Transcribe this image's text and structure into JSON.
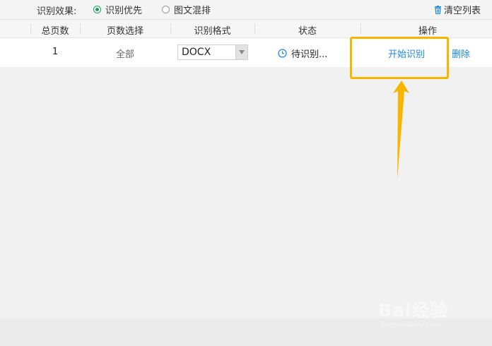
{
  "toolbar": {
    "effect_label": "识别效果:",
    "option_priority": "识别优先",
    "option_mixed": "图文混排",
    "selected_option": "识别优先",
    "clear_list": "清空列表"
  },
  "table": {
    "columns": [
      "总页数",
      "页数选择",
      "识别格式",
      "状态",
      "操作"
    ],
    "rows": [
      {
        "total_pages": "1",
        "page_selection": "全部",
        "format": "DOCX",
        "status": "待识别...",
        "action_start": "开始识别",
        "action_delete": "删除"
      }
    ]
  },
  "watermark": {
    "logo_text": "Bai经验",
    "url": "jingyan.baidu.com"
  },
  "colors": {
    "link": "#1c8ad8",
    "highlight": "#f7b500",
    "radio_selected": "#18a058"
  }
}
